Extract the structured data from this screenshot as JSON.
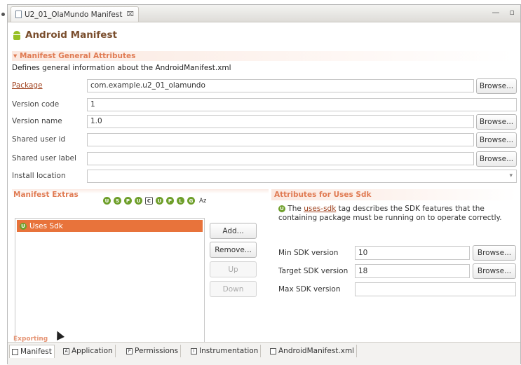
{
  "editor": {
    "tab_title": "U2_01_OlaMundo Manifest",
    "tab_close": "⌧",
    "minimize": "—",
    "restore": "▫"
  },
  "manifest": {
    "title": "Android Manifest",
    "general_section": "Manifest General Attributes",
    "description": "Defines general information about the AndroidManifest.xml",
    "fields": {
      "package": {
        "label": "Package",
        "value": "com.example.u2_01_olamundo",
        "button": "Browse..."
      },
      "version_code": {
        "label": "Version code",
        "value": "1"
      },
      "version_name": {
        "label": "Version name",
        "value": "1.0",
        "button": "Browse..."
      },
      "shared_user_id": {
        "label": "Shared user id",
        "value": "",
        "button": "Browse..."
      },
      "shared_user_label": {
        "label": "Shared user label",
        "value": "",
        "button": "Browse..."
      },
      "install_location": {
        "label": "Install location",
        "value": ""
      }
    }
  },
  "extras": {
    "title": "Manifest Extras",
    "filters": [
      "U",
      "S",
      "P",
      "U",
      "C",
      "U",
      "P",
      "L",
      "G"
    ],
    "sort": "Az",
    "list": [
      {
        "label": "Uses Sdk",
        "selected": true
      }
    ],
    "buttons": {
      "add": "Add...",
      "remove": "Remove...",
      "up": "Up",
      "down": "Down"
    }
  },
  "attributes": {
    "title": "Attributes for Uses Sdk",
    "info_prefix": "The",
    "info_link": "uses-sdk",
    "info_suffix": "tag describes the SDK features that the containing package must be running on to operate correctly.",
    "min_sdk": {
      "label": "Min SDK version",
      "value": "10",
      "button": "Browse..."
    },
    "target_sdk": {
      "label": "Target SDK version",
      "value": "18",
      "button": "Browse..."
    },
    "max_sdk": {
      "label": "Max SDK version",
      "value": ""
    }
  },
  "bottom_section": "Exporting",
  "bottom_tabs": [
    {
      "label": "Manifest",
      "active": true
    },
    {
      "label": "Application"
    },
    {
      "label": "Permissions"
    },
    {
      "label": "Instrumentation"
    },
    {
      "label": "AndroidManifest.xml"
    }
  ],
  "colors": {
    "accent": "#e07b53",
    "selection": "#e8733b",
    "android_green": "#97c024"
  }
}
